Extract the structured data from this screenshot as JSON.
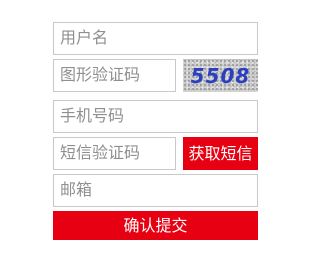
{
  "form": {
    "username_placeholder": "用户名",
    "captcha_placeholder": "图形验证码",
    "captcha_code": "5508",
    "phone_placeholder": "手机号码",
    "sms_placeholder": "短信验证码",
    "sms_button_label": "获取短信",
    "email_placeholder": "邮箱",
    "submit_label": "确认提交"
  },
  "colors": {
    "accent": "#e60012",
    "input_border": "#c9c9c9",
    "placeholder_text": "#8f8f8f",
    "captcha_text": "#2b3fbf"
  }
}
